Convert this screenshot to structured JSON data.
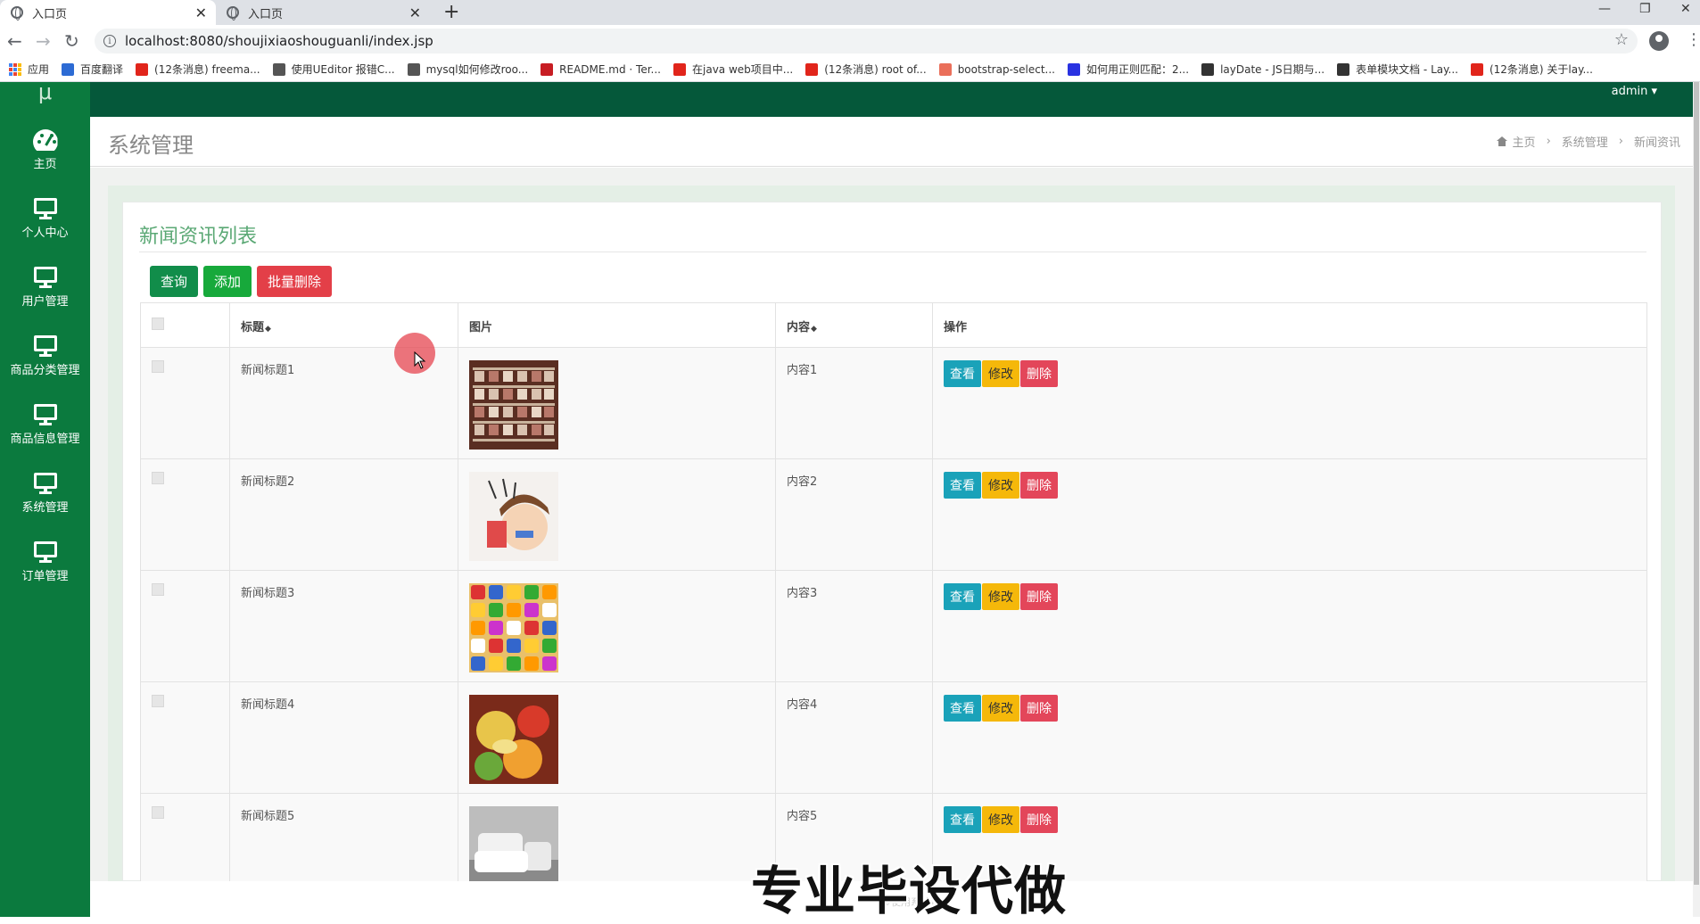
{
  "browser": {
    "tabs": [
      {
        "title": "入口页",
        "active": true
      },
      {
        "title": "入口页",
        "active": false
      }
    ],
    "url": "localhost:8080/shoujixiaoshouguanli/index.jsp",
    "bookmarks": [
      {
        "label": "应用",
        "icon": "apps-grid-icon"
      },
      {
        "label": "百度翻译",
        "icon": "baidu-translate-icon",
        "color": "#2d6bd4"
      },
      {
        "label": "(12条消息) freema...",
        "icon": "csdn-icon",
        "color": "#e1251b"
      },
      {
        "label": "使用UEditor 报错C...",
        "icon": "ueditor-icon",
        "color": "#555555"
      },
      {
        "label": "mysql如何修改roo...",
        "icon": "ueditor-icon",
        "color": "#555555"
      },
      {
        "label": "README.md · Ter...",
        "icon": "gitee-icon",
        "color": "#c71d23"
      },
      {
        "label": "在java web项目中...",
        "icon": "csdn-icon",
        "color": "#e1251b"
      },
      {
        "label": "(12条消息) root of...",
        "icon": "csdn-icon",
        "color": "#e1251b"
      },
      {
        "label": "bootstrap-select...",
        "icon": "jianshu-icon",
        "color": "#ea6f5a"
      },
      {
        "label": "如何用正则匹配：2...",
        "icon": "baidu-paw-icon",
        "color": "#2932e1"
      },
      {
        "label": "layDate - JS日期与...",
        "icon": "layui-icon",
        "color": "#333333"
      },
      {
        "label": "表单模块文档 - Lay...",
        "icon": "layui-icon",
        "color": "#333333"
      },
      {
        "label": "(12条消息) 关于lay...",
        "icon": "csdn-icon",
        "color": "#e1251b"
      }
    ]
  },
  "app": {
    "logo": "μ",
    "admin": "admin ▾",
    "sidebar": [
      {
        "label": "主页",
        "icon": "dashboard-icon"
      },
      {
        "label": "个人中心",
        "icon": "monitor-icon"
      },
      {
        "label": "用户管理",
        "icon": "monitor-icon"
      },
      {
        "label": "商品分类管理",
        "icon": "monitor-icon"
      },
      {
        "label": "商品信息管理",
        "icon": "monitor-icon"
      },
      {
        "label": "系统管理",
        "icon": "monitor-icon"
      },
      {
        "label": "订单管理",
        "icon": "monitor-icon"
      }
    ],
    "page_title": "系统管理",
    "breadcrumb": [
      "主页",
      "系统管理",
      "新闻资讯"
    ],
    "card_title": "新闻资讯列表",
    "buttons": {
      "query": "查询",
      "add": "添加",
      "batch_delete": "批量删除"
    },
    "table": {
      "headers": {
        "title": "标题",
        "image": "图片",
        "content": "内容",
        "ops": "操作"
      },
      "sort_glyph": "◆",
      "rows": [
        {
          "title": "新闻标题1",
          "content": "内容1",
          "image": "shoe-rack-photo"
        },
        {
          "title": "新闻标题2",
          "content": "内容2",
          "image": "cartoon-photo"
        },
        {
          "title": "新闻标题3",
          "content": "内容3",
          "image": "snacks-photo"
        },
        {
          "title": "新闻标题4",
          "content": "内容4",
          "image": "fruit-photo"
        },
        {
          "title": "新闻标题5",
          "content": "内容5",
          "image": "sofa-photo"
        }
      ],
      "ops": {
        "view": "查看",
        "edit": "修改",
        "delete": "删除"
      }
    },
    "footer_text": "©使用系统管理",
    "watermark": "专业毕设代做"
  },
  "colors": {
    "sidebar": "#0b7a3e",
    "topbar": "#05583a",
    "view": "#1aa2b9",
    "edit": "#f5b80a",
    "delete": "#e3465a"
  }
}
